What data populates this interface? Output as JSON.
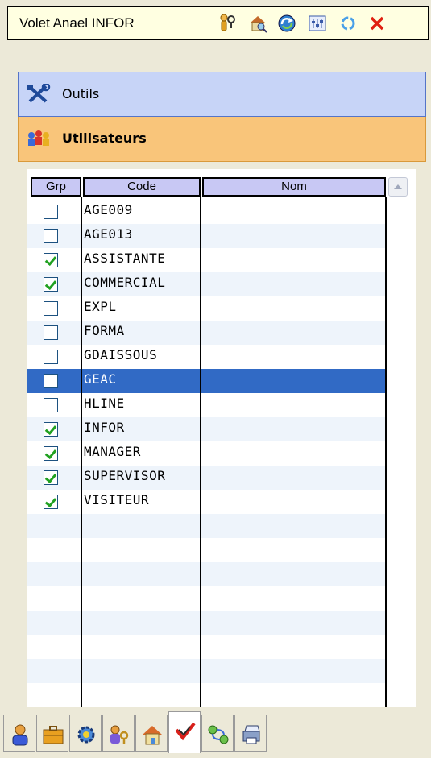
{
  "window": {
    "title": "Volet Anael INFOR"
  },
  "toolbar_icons": [
    "user-key-icon",
    "house-search-icon",
    "refresh-globe-icon",
    "settings-panel-icon",
    "sync-icon",
    "close-icon"
  ],
  "sections": {
    "outils": {
      "label": "Outils",
      "icon": "tools-icon"
    },
    "utilisateurs": {
      "label": "Utilisateurs",
      "icon": "users-icon"
    }
  },
  "grid": {
    "columns": [
      "Grp",
      "Code",
      "Nom"
    ],
    "rows": [
      {
        "code": "AGE009",
        "grp": false
      },
      {
        "code": "AGE013",
        "grp": false
      },
      {
        "code": "ASSISTANTE",
        "grp": true
      },
      {
        "code": "COMMERCIAL",
        "grp": true
      },
      {
        "code": "EXPL",
        "grp": false
      },
      {
        "code": "FORMA",
        "grp": false
      },
      {
        "code": "GDAISSOUS",
        "grp": false
      },
      {
        "code": "GEAC",
        "grp": false,
        "selected": true
      },
      {
        "code": "HLINE",
        "grp": false
      },
      {
        "code": "INFOR",
        "grp": true
      },
      {
        "code": "MANAGER",
        "grp": true
      },
      {
        "code": "SUPERVISOR",
        "grp": true
      },
      {
        "code": "VISITEUR",
        "grp": true
      }
    ]
  },
  "tabs": [
    {
      "icon": "user-icon"
    },
    {
      "icon": "briefcase-icon"
    },
    {
      "icon": "gear-icon"
    },
    {
      "icon": "user-key-icon"
    },
    {
      "icon": "house-icon"
    },
    {
      "icon": "check-flag-icon",
      "active": true
    },
    {
      "icon": "network-icon"
    },
    {
      "icon": "print-icon"
    }
  ],
  "colors": {
    "selection": "#316ac5",
    "checkmark": "#21a121",
    "outils_bg": "#c7d4f7",
    "utilisateurs_bg": "#f9c57a"
  }
}
